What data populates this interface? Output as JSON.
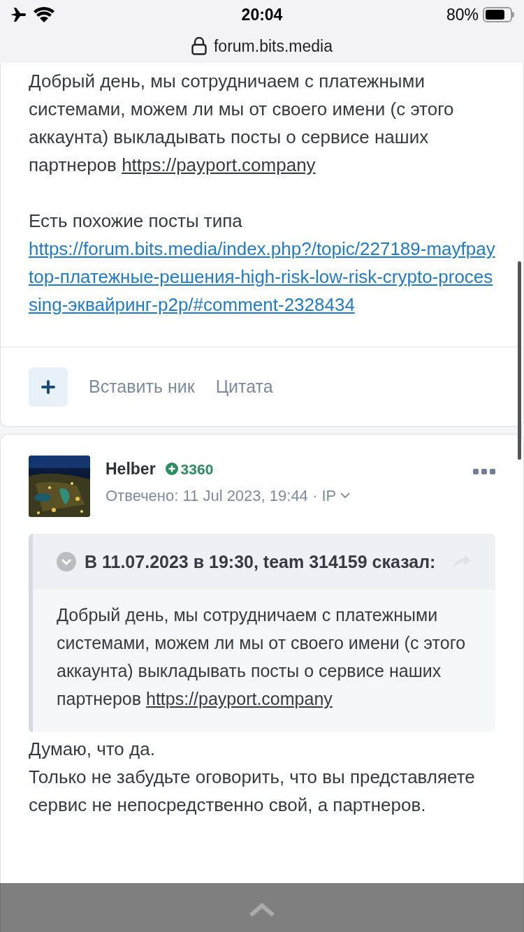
{
  "status_bar": {
    "time": "20:04",
    "battery": "80%"
  },
  "address_bar": {
    "url": "forum.bits.media"
  },
  "previous_post": {
    "paragraphs": [
      {
        "text": "Добрый день, мы сотрудничаем с платежными системами, можем ли мы от своего имени (с этого аккаунта) выкладывать посты о сервисе наших партнеров",
        "link": "https://payport.company",
        "kind": "inline"
      },
      {
        "text": "Есть похожие посты типа",
        "link": "https://forum.bits.media/index.php?/topic/227189-mayfpaytop-платежные-решения-high-risk-low-risk-crypto-processing-эквайринг-p2p/#comment-2328434",
        "kind": "block"
      }
    ],
    "actions": [
      "Вставить ник",
      "Цитата"
    ]
  },
  "reply": {
    "author": "Helber",
    "reputation": "3360",
    "meta": "Отвечено: 11 Jul 2023, 19:44 · IP",
    "quote": {
      "header": "В 11.07.2023 в 19:30, team 314159 сказал:",
      "expanded": false,
      "text": "Добрый день, мы сотрудничаем с платежными системами, можем ли мы от своего имени (с этого аккаунта) выкладывать посты о сервисе наших партнеров",
      "link": "https://payport.company",
      "kind": "inline"
    },
    "paragraphs": [
      "Думаю, что да.",
      "Только не забудьте оговорить, что вы представляете сервис не непосредственно свой, а партнеров."
    ]
  }
}
